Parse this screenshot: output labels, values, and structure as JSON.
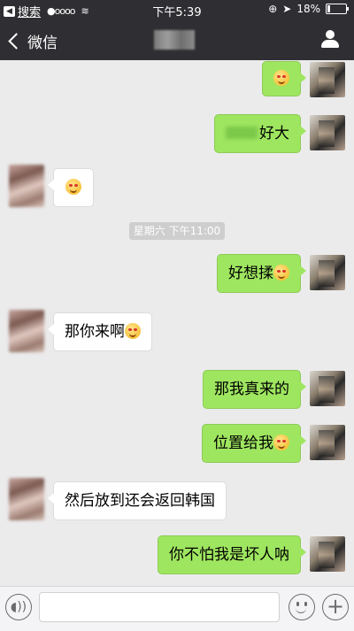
{
  "status_bar": {
    "back_app": "搜索",
    "signal": "●oooo",
    "wifi": "≋",
    "time": "下午5:39",
    "battery": "18%",
    "icons": [
      "location-lock-icon",
      "location-arrow-icon",
      "battery-icon"
    ]
  },
  "nav": {
    "back_label": "微信",
    "profile_icon": "person-icon"
  },
  "messages": [
    {
      "side": "self",
      "text": "",
      "emoji": true
    },
    {
      "side": "self",
      "text": "好大",
      "blurred_prefix": true
    },
    {
      "side": "other",
      "text": "",
      "emoji": true
    },
    {
      "side": "self",
      "text": "好想揉",
      "emoji": true
    },
    {
      "side": "other",
      "text": "那你来啊",
      "emoji": true
    },
    {
      "side": "self",
      "text": "那我真来的"
    },
    {
      "side": "self",
      "text": "位置给我",
      "emoji": true
    },
    {
      "side": "other",
      "text": "然后放到还会返回韩国"
    },
    {
      "side": "self",
      "text": "你不怕我是坏人呐"
    }
  ],
  "timestamp": "星期六 下午11:00",
  "input": {
    "voice_icon": "voice-icon",
    "emoji_icon": "emoji-icon",
    "plus_icon": "plus-icon"
  }
}
